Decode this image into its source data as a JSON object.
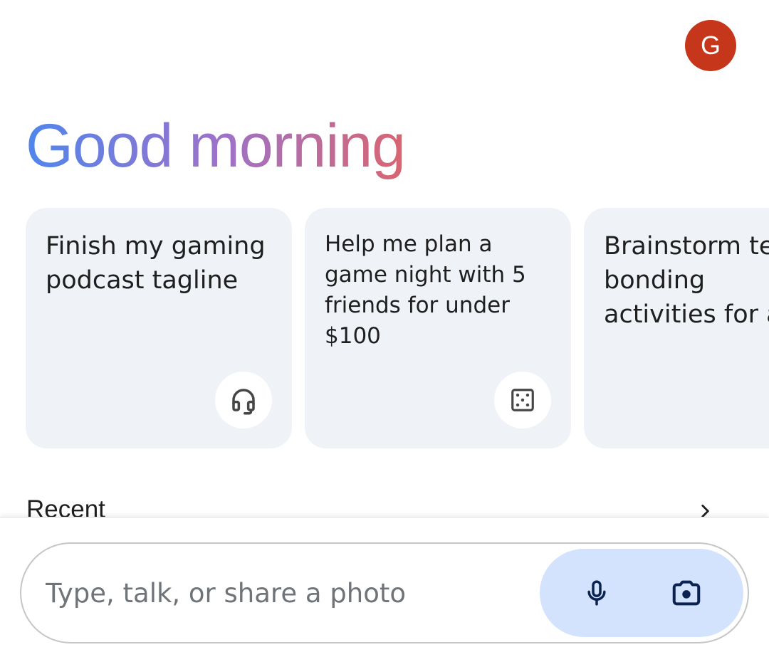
{
  "profile": {
    "avatar_letter": "G",
    "avatar_color": "#c5361a"
  },
  "greeting": {
    "text": "Good morning",
    "gradient_colors": [
      "#4f86ec",
      "#9b72cb",
      "#d96570"
    ]
  },
  "suggestions": [
    {
      "text": "Finish my gaming podcast tagline",
      "icon": "headphones-icon"
    },
    {
      "text": "Help me plan a game night with 5 friends for under $100",
      "icon": "dice-icon"
    },
    {
      "text": "Brainstorm team bonding activities for a work retreat",
      "icon": null
    }
  ],
  "recent": {
    "title": "Recent",
    "arrow_icon": "chevron-right-icon"
  },
  "composer": {
    "placeholder": "Type, talk, or share a photo",
    "value": "",
    "mic_icon": "microphone-icon",
    "camera_icon": "camera-icon",
    "pill_color": "#d3e3fd",
    "icon_color": "#0b2351"
  }
}
